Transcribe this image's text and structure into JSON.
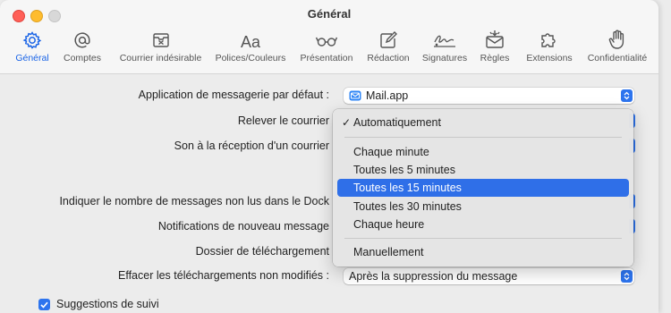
{
  "window": {
    "title": "Général"
  },
  "toolbar": {
    "items": [
      {
        "label": "Général",
        "icon": "gear-icon",
        "active": true
      },
      {
        "label": "Comptes",
        "icon": "at-icon",
        "active": false
      },
      {
        "label": "Courrier indésirable",
        "icon": "junk-tray-icon",
        "active": false
      },
      {
        "label": "Polices/Couleurs",
        "icon": "fonts-icon",
        "active": false
      },
      {
        "label": "Présentation",
        "icon": "glasses-icon",
        "active": false
      },
      {
        "label": "Rédaction",
        "icon": "compose-icon",
        "active": false
      },
      {
        "label": "Signatures",
        "icon": "signature-icon",
        "active": false
      },
      {
        "label": "Règles",
        "icon": "rules-envelope-icon",
        "active": false
      },
      {
        "label": "Extensions",
        "icon": "puzzle-icon",
        "active": false
      },
      {
        "label": "Confidentialité",
        "icon": "hand-icon",
        "active": false
      }
    ]
  },
  "settings": {
    "default_app": {
      "label": "Application de messagerie par défaut :",
      "value": "Mail.app",
      "value_icon": "mail-app-icon"
    },
    "check_mail": {
      "label": "Relever le courrier"
    },
    "new_mail_sound": {
      "label": "Son à la réception d'un courrier"
    },
    "dock_unread": {
      "label": "Indiquer le nombre de messages non lus dans le Dock"
    },
    "new_notifications": {
      "label": "Notifications de nouveau message"
    },
    "downloads_folder": {
      "label": "Dossier de téléchargement"
    },
    "remove_downloads": {
      "label": "Effacer les téléchargements non modifiés :",
      "value": "Après la suppression du message"
    },
    "follow_up": {
      "label": "Suggestions de suivi",
      "checked": true
    }
  },
  "menu": {
    "selected": "Automatiquement",
    "highlighted": "Toutes les 15 minutes",
    "items": [
      "Automatiquement",
      "Chaque minute",
      "Toutes les 5 minutes",
      "Toutes les 15 minutes",
      "Toutes les 30 minutes",
      "Chaque heure",
      "Manuellement"
    ]
  },
  "colors": {
    "accent": "#2d74ee",
    "highlight": "#2f6fe8",
    "close": "#ff5f57",
    "minimize": "#febc2e"
  }
}
